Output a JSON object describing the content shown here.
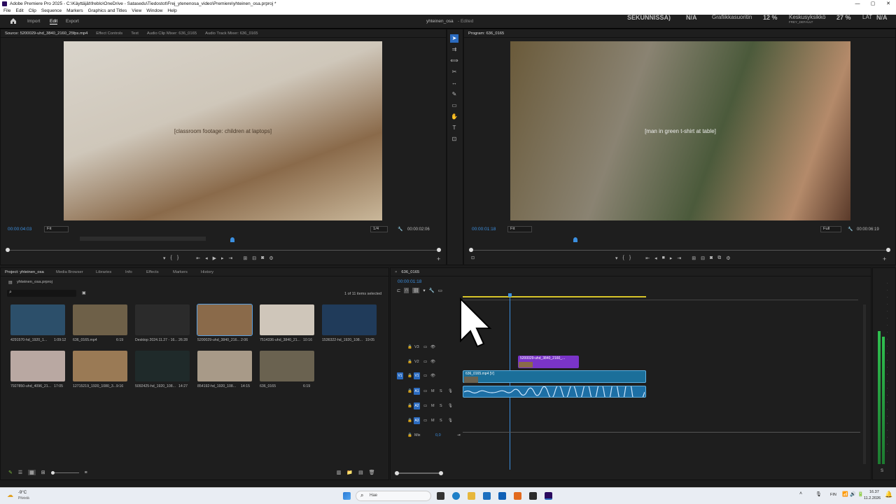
{
  "window": {
    "title": "Adobe Premiere Pro 2025 - C:\\Käyttäjät\\freblo\\OneDrive - Satasedu\\Tiedostot\\Frej_ytenenosa_video\\Premiere\\yhteinen_osa.prproj *",
    "controls": [
      "—",
      "▢",
      "✕"
    ]
  },
  "menu": [
    "File",
    "Edit",
    "Clip",
    "Sequence",
    "Markers",
    "Graphics and Titles",
    "View",
    "Window",
    "Help"
  ],
  "workspace": {
    "import": "Import",
    "edit": "Edit",
    "export": "Export",
    "project_name": "yhteinen_osa",
    "edited": "- Edited"
  },
  "overlay": {
    "s1": "SEKUNNISSA)",
    "s2": "N/A",
    "s3_label": "Grafiikkasuoritin",
    "s3_val": "12 %",
    "s4_label": "Keskusyksikkö",
    "s4_val": "27 %",
    "s4_sub": "FREY_DEFAULT",
    "s5": "LAT",
    "s6": "N/A"
  },
  "source": {
    "tabs": [
      "Source: 5200029-uhd_3840_2160_25fps.mp4",
      "Effect Controls",
      "Text",
      "Audio Clip Mixer: 636_0165",
      "Audio Track Mixer: 636_0165"
    ],
    "timecode": "00:00:04:03",
    "fit": "Fit",
    "res": "1/4",
    "duration": "00:00:02:06",
    "progress": 0.52,
    "video": "[classroom footage: children at laptops]"
  },
  "program": {
    "tab": "Program: 636_0165",
    "timecode": "00:00:01:18",
    "fit": "Fit",
    "res": "Full",
    "duration": "00:00:06:19",
    "progress": 0.25,
    "video": "[man in green t-shirt at table]"
  },
  "project": {
    "tabs": [
      "Project: yhteinen_osa",
      "Media Browser",
      "Libraries",
      "Info",
      "Effects",
      "Markers",
      "History"
    ],
    "file": "yhteinen_osa.prproj",
    "count": "1 of 11 items selected",
    "items": [
      {
        "name": "4291570-hd_1920_1...",
        "dur": "1:09:12",
        "color": "#2c4f6a"
      },
      {
        "name": "636_0165.mp4",
        "dur": "6:19",
        "color": "#6e6048"
      },
      {
        "name": "Desktop 2024.11.27 - 16...",
        "dur": "26:28",
        "color": "#2b2b2b"
      },
      {
        "name": "5200029-uhd_3840_216...",
        "dur": "2:06",
        "color": "#8a6a4a"
      },
      {
        "name": "7514336-uhd_3840_21...",
        "dur": "10:16",
        "color": "#cfc6ba"
      },
      {
        "name": "1536322-hd_1920_108...",
        "dur": "19:05",
        "color": "#203b5a"
      },
      {
        "name": "7927850-uhd_4096_21...",
        "dur": "17:05",
        "color": "#b9a8a2"
      },
      {
        "name": "12715219_1920_1080_3...",
        "dur": "9:16",
        "color": "#9a7a55"
      },
      {
        "name": "5092425-hd_1920_108...",
        "dur": "14:27",
        "color": "#1f2a2a"
      },
      {
        "name": "854192-hd_1920_108...",
        "dur": "14:15",
        "color": "#a89a88"
      },
      {
        "name": "636_0165",
        "dur": "6:19",
        "color": "#6a6250"
      }
    ]
  },
  "timeline": {
    "tab": "636_0165",
    "timecode": "00:00:01:18",
    "tracks": [
      "V3",
      "V2",
      "V1",
      "A1",
      "A2",
      "A3"
    ],
    "mix_label": "Mix",
    "mix_val": "0,0",
    "clip_v2": "5200029-uhd_3840_2160_...",
    "clip_v1": "636_0165.mp4 [V]"
  },
  "taskbar": {
    "temp": "-9°C",
    "weather": "Pilvistä",
    "search": "Hae",
    "lang": "FIN",
    "time": "16.37",
    "date": "11.2.2026"
  },
  "colors": {
    "accent": "#3b8fe0",
    "clip_v1": "#1b6f9a",
    "clip_v2": "#7a34c8",
    "audio": "#1d6fa5"
  }
}
